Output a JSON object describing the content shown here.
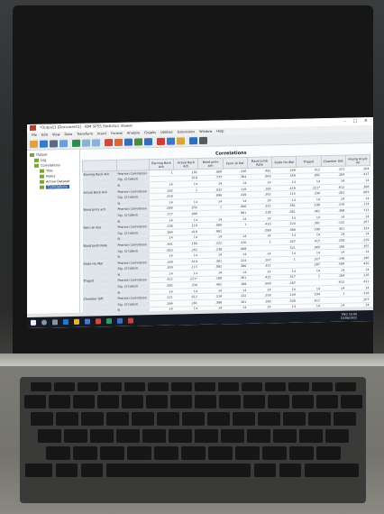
{
  "window": {
    "title": "*Output1 [Document1] - IBM SPSS Statistics Viewer",
    "controls": "– ▢ ✕"
  },
  "menu": [
    "File",
    "Edit",
    "View",
    "Data",
    "Transform",
    "Insert",
    "Format",
    "Analyze",
    "Graphs",
    "Utilities",
    "Extensions",
    "Window",
    "Help"
  ],
  "nav": {
    "items": [
      "Output",
      "Log",
      "Correlations",
      "Title",
      "Notes",
      "Active Dataset",
      "Correlations"
    ]
  },
  "table": {
    "title": "Correlations",
    "headers": [
      "",
      "",
      "Earning Back Ach",
      "Actual Back Ach",
      "Bond price ach",
      "Farm sh Kat",
      "Baud Jumb Rate",
      "Oudo Hu Wal",
      "Thigort",
      "Chamber Gift",
      "Houng Acunt Vil"
    ],
    "stat_labels": [
      "Pearson Correlation",
      "Sig. (2-tailed)",
      "N"
    ],
    "variables": [
      "Earning Back Ach",
      "Actual Back Ach",
      "Bond price ach",
      "Farm sh Kat",
      "Baud Jumb Rate",
      "Oudo Hu Wal",
      "Thigort",
      "Chamber Gift"
    ],
    "rows": [
      [
        "1",
        ".192",
        ".069",
        ".236",
        ".481",
        ".169",
        ".412",
        ".221",
        ".204"
      ],
      [
        "",
        ".618",
        ".777",
        ".384",
        ".063",
        ".359",
        ".092",
        ".284",
        ".417"
      ],
      [
        "14",
        "14",
        "14",
        "14",
        "14",
        "14",
        "14",
        "14",
        "14"
      ],
      [
        ".192",
        "1",
        ".032",
        ".119",
        ".166",
        ".419",
        ".221*",
        ".612",
        ".308"
      ],
      [
        ".618",
        "",
        ".896",
        ".419",
        ".262",
        ".115",
        ".330",
        ".281",
        ".093"
      ],
      [
        "14",
        "14",
        "14",
        "14",
        "14",
        "14",
        "14",
        "14",
        "14"
      ],
      [
        ".069",
        ".032",
        "1",
        ".006",
        ".222",
        ".361",
        ".189",
        ".216",
        ".114"
      ],
      [
        ".777",
        ".896",
        "",
        ".981",
        ".238",
        ".081",
        ".462",
        ".398",
        ".713"
      ],
      [
        "14",
        "14",
        "14",
        "14",
        "14",
        "14",
        "14",
        "14",
        "14"
      ],
      [
        ".236",
        ".119",
        ".006",
        "1",
        ".410",
        ".224",
        ".301",
        ".132",
        ".267"
      ],
      [
        ".384",
        ".419",
        ".981",
        "",
        ".088",
        ".380",
        ".188",
        ".301",
        ".324"
      ],
      [
        "14",
        "14",
        "14",
        "14",
        "14",
        "14",
        "14",
        "14",
        "14"
      ],
      [
        ".481",
        ".166",
        ".222",
        ".410",
        "1",
        ".267",
        ".415",
        ".258",
        ".229"
      ],
      [
        ".063",
        ".262",
        ".238",
        ".088",
        "",
        ".321",
        ".069",
        ".190",
        ".355"
      ],
      [
        "14",
        "14",
        "14",
        "14",
        "14",
        "14",
        "14",
        "14",
        "14"
      ],
      [
        ".169",
        ".419",
        ".361",
        ".224",
        ".267",
        "1",
        ".327",
        ".149",
        ".196"
      ],
      [
        ".359",
        ".115",
        ".081",
        ".380",
        ".321",
        "",
        ".287",
        ".509",
        ".420"
      ],
      [
        "14",
        "14",
        "14",
        "14",
        "14",
        "14",
        "14",
        "14",
        "14"
      ],
      [
        ".412",
        ".221*",
        ".189",
        ".301",
        ".415",
        ".327",
        "1",
        ".184",
        ".216"
      ],
      [
        ".092",
        ".330",
        ".462",
        ".188",
        ".069",
        ".287",
        "",
        ".612",
        ".411"
      ],
      [
        "14",
        "14",
        "14",
        "14",
        "14",
        "14",
        "14",
        "14",
        "14"
      ],
      [
        ".221",
        ".612",
        ".216",
        ".132",
        ".258",
        ".149",
        ".184",
        "1",
        ".318"
      ],
      [
        ".284",
        ".281",
        ".398",
        ".301",
        ".190",
        ".509",
        ".612",
        "",
        ".207"
      ],
      [
        "14",
        "14",
        "14",
        "14",
        "14",
        "14",
        "14",
        "14",
        "14"
      ]
    ]
  },
  "taskbar": {
    "time": "16:00",
    "date": "10/06/2022",
    "lang": "ENG"
  },
  "colors": {
    "accent": "#2d5fa8",
    "taskbar": "#151a24"
  }
}
